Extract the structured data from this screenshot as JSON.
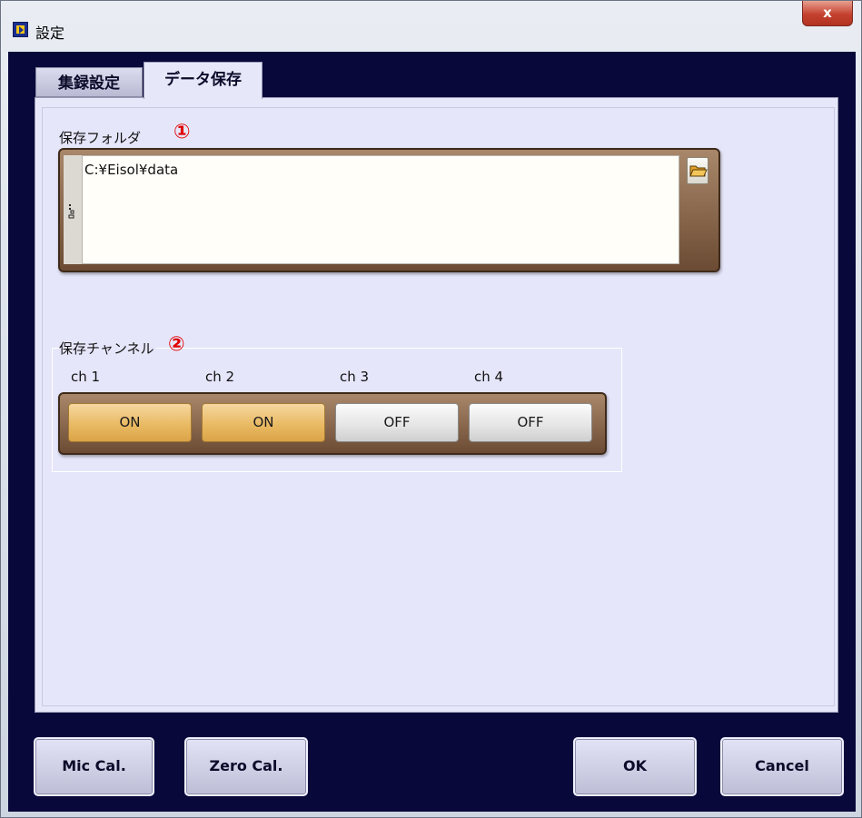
{
  "window": {
    "title": "設定",
    "close_symbol": "x",
    "app_icon": "labview-app-icon"
  },
  "tabs": [
    {
      "label": "集録設定",
      "active": false
    },
    {
      "label": "データ保存",
      "active": true
    }
  ],
  "folder_section": {
    "label": "保存フォルダ",
    "marker": "①",
    "path_value": "C:¥Eisol¥data",
    "browse_icon": "folder-open-icon"
  },
  "channel_section": {
    "label": "保存チャンネル",
    "marker": "②",
    "channels": [
      {
        "name": "ch 1",
        "state": "ON"
      },
      {
        "name": "ch 2",
        "state": "ON"
      },
      {
        "name": "ch 3",
        "state": "OFF"
      },
      {
        "name": "ch 4",
        "state": "OFF"
      }
    ]
  },
  "buttons": {
    "mic_cal": "Mic Cal.",
    "zero_cal": "Zero Cal.",
    "ok": "OK",
    "cancel": "Cancel"
  },
  "colors": {
    "client_bg": "#08083a",
    "panel_bg": "#e7e7fa",
    "marker": "#e00000",
    "on_button": "#e8b860",
    "off_button": "#e4e4e4"
  }
}
